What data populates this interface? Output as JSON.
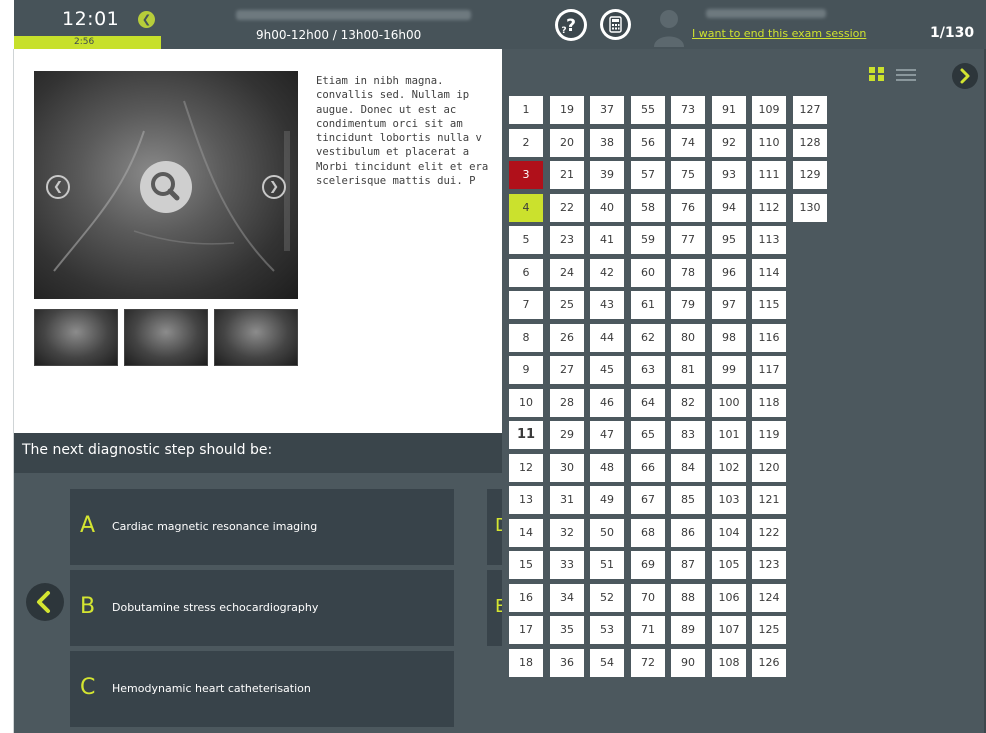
{
  "header": {
    "clock": "12:01",
    "countdown": "2:56",
    "session_time": "9h00-12h00 / 13h00-16h00",
    "end_session_link": "I want to end this exam session",
    "progress": "1/130"
  },
  "stem": {
    "text": "Etiam in nibh magna. \nconvallis sed. Nullam ip\naugue. Donec ut est ac\ncondimentum orci sit am\ntincidunt lobortis nulla v\nvestibulum et placerat a\nMorbi tincidunt elit et era\nscelerisque mattis dui. P"
  },
  "question": {
    "text": "The next diagnostic step should be:"
  },
  "answers": [
    {
      "letter": "A",
      "text": "Cardiac magnetic resonance imaging"
    },
    {
      "letter": "B",
      "text": "Dobutamine stress echocardiography"
    },
    {
      "letter": "C",
      "text": "Hemodynamic heart catheterisation"
    }
  ],
  "answers_peek": [
    {
      "letter": "D"
    },
    {
      "letter": "E"
    }
  ],
  "navigator": {
    "columns": [
      [
        "1",
        "2",
        "3",
        "4",
        "5",
        "6",
        "7",
        "8",
        "9",
        "10",
        "11",
        "12",
        "13",
        "14",
        "15",
        "16",
        "17",
        "18"
      ],
      [
        "19",
        "20",
        "21",
        "22",
        "23",
        "24",
        "25",
        "26",
        "27",
        "28",
        "29",
        "30",
        "31",
        "32",
        "33",
        "34",
        "35",
        "36"
      ],
      [
        "37",
        "38",
        "39",
        "40",
        "41",
        "42",
        "43",
        "44",
        "45",
        "46",
        "47",
        "48",
        "49",
        "50",
        "51",
        "52",
        "53",
        "54"
      ],
      [
        "55",
        "56",
        "57",
        "58",
        "59",
        "60",
        "61",
        "62",
        "63",
        "64",
        "65",
        "66",
        "67",
        "68",
        "69",
        "70",
        "71",
        "72"
      ],
      [
        "73",
        "74",
        "75",
        "76",
        "77",
        "78",
        "79",
        "80",
        "81",
        "82",
        "83",
        "84",
        "85",
        "86",
        "87",
        "88",
        "89",
        "90"
      ],
      [
        "91",
        "92",
        "93",
        "94",
        "95",
        "96",
        "97",
        "98",
        "99",
        "100",
        "101",
        "102",
        "103",
        "104",
        "105",
        "106",
        "107",
        "108"
      ],
      [
        "109",
        "110",
        "111",
        "112",
        "113",
        "114",
        "115",
        "116",
        "117",
        "118",
        "119",
        "120",
        "121",
        "122",
        "123",
        "124",
        "125",
        "126"
      ],
      [
        "127",
        "128",
        "129",
        "130"
      ]
    ],
    "flagged": "3",
    "current": "4",
    "emphasized": "11",
    "flag_color": "#b0101a",
    "current_color": "#cbe12d"
  },
  "colors": {
    "accent": "#cbe12d",
    "header_bg": "#475359",
    "panel_bg": "#4c585e"
  },
  "icons": {
    "help": "help-question-icon",
    "calculator": "calculator-icon",
    "avatar": "user-avatar-icon",
    "grid_view": "grid-view-icon",
    "list_view": "list-view-icon"
  }
}
